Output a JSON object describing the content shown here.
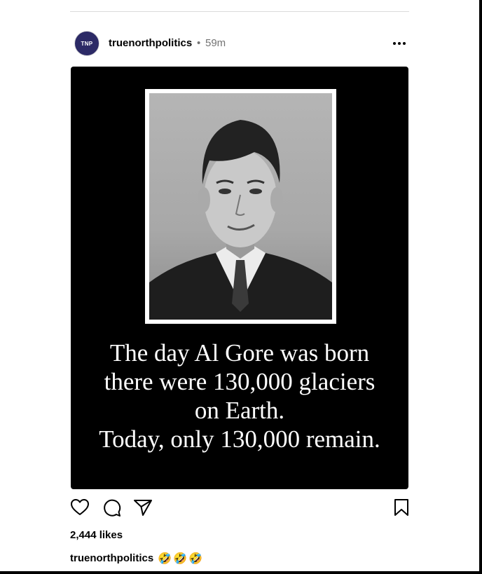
{
  "post": {
    "username": "truenorthpolitics",
    "separator": "•",
    "time": "59m",
    "avatar_text": "TNP",
    "image_text": [
      "The day Al Gore was born",
      "there were 130,000 glaciers",
      "on Earth.",
      "Today, only 130,000 remain."
    ],
    "likes": "2,444 likes",
    "caption_user": "truenorthpolitics",
    "caption_emojis": [
      "🤣",
      "🤣",
      "🤣"
    ]
  },
  "icons": {
    "more": "more-options-icon",
    "like": "heart-icon",
    "comment": "comment-icon",
    "share": "share-icon",
    "save": "bookmark-icon"
  }
}
